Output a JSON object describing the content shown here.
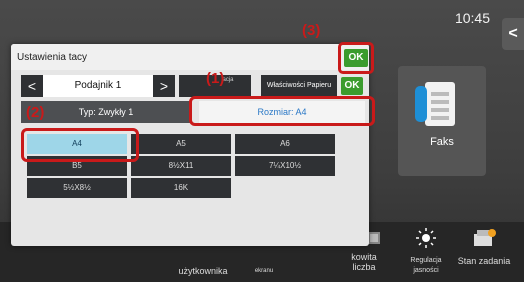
{
  "home": {
    "clock": "10:45",
    "home_glyph": "<",
    "fax_label": "Faks"
  },
  "bottom_bar": {
    "items": [
      {
        "label": "użytkownika",
        "icon": "person-icon"
      },
      {
        "label": "ekranu",
        "icon": "screen-icon"
      },
      {
        "label": "kowita\nliczba",
        "icon": "counter-icon"
      },
      {
        "label": "Regulacja\njasności",
        "icon": "brightness-icon"
      },
      {
        "label": "Stan zadania",
        "icon": "job-status-icon"
      }
    ]
  },
  "dialog": {
    "title": "Ustawienia tacy",
    "ok_label": "OK",
    "tray_prev": "<",
    "tray_name": "Podajnik 1",
    "tray_next": ">",
    "cut_label": "acja",
    "paper_props_label": "Właściwości Papieru",
    "ok_small_label": "OK",
    "tab_type": "Typ: Zwykły 1",
    "tab_size": "Rozmiar: A4",
    "sizes": [
      "A4",
      "A5",
      "A6",
      "B5",
      "8½X11",
      "7¼X10½",
      "5½X8½",
      "16K"
    ],
    "selected_size": "A4"
  },
  "callouts": {
    "c1": "(1)",
    "c2": "(2)",
    "c3": "(3)"
  },
  "colors": {
    "ok_green": "#3b9c2e",
    "highlight_red": "#c91a1a",
    "selected_cell": "#9ed6e8",
    "size_tab_text": "#2a78c6"
  }
}
